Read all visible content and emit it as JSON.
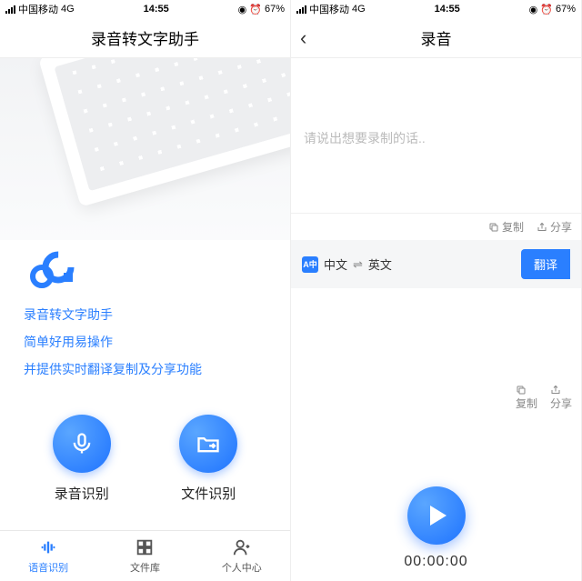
{
  "status": {
    "carrier": "中国移动",
    "network": "4G",
    "time": "14:55",
    "battery": "67%"
  },
  "left": {
    "title": "录音转文字助手",
    "intro": [
      "录音转文字助手",
      "简单好用易操作",
      "并提供实时翻译复制及分享功能"
    ],
    "actions": {
      "record": "录音识别",
      "file": "文件识别"
    },
    "tabs": {
      "voice": "语音识别",
      "files": "文件库",
      "profile": "个人中心"
    }
  },
  "right": {
    "title": "录音",
    "placeholder": "请说出想要录制的话..",
    "tools": {
      "copy": "复制",
      "share": "分享"
    },
    "lang": {
      "from": "中文",
      "to": "英文"
    },
    "translate": "翻译",
    "timer": "00:00:00"
  }
}
